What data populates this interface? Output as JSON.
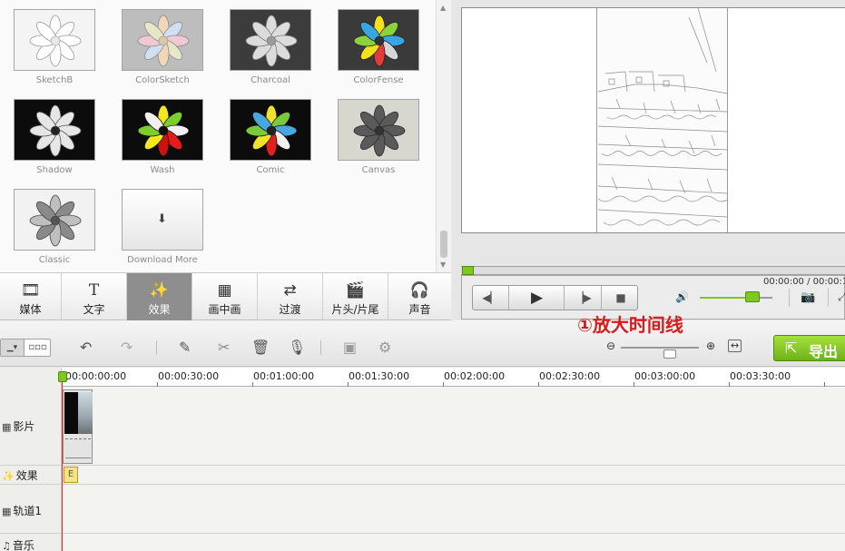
{
  "effects": [
    {
      "name": "SketchB",
      "style": "sketch"
    },
    {
      "name": "ColorSketch",
      "style": "colorsketch"
    },
    {
      "name": "Charcoal",
      "style": "charcoal"
    },
    {
      "name": "ColorFense",
      "style": "colorfense"
    },
    {
      "name": "Shadow",
      "style": "shadow"
    },
    {
      "name": "Wash",
      "style": "wash"
    },
    {
      "name": "Comic",
      "style": "comic"
    },
    {
      "name": "Canvas",
      "style": "canvas"
    },
    {
      "name": "Classic",
      "style": "classic"
    },
    {
      "name": "Download More",
      "style": "download"
    }
  ],
  "tabs": [
    {
      "label": "媒体",
      "icon": "media-icon"
    },
    {
      "label": "文字",
      "icon": "text-icon"
    },
    {
      "label": "效果",
      "icon": "effects-wand-icon",
      "active": true
    },
    {
      "label": "画中画",
      "icon": "pip-icon"
    },
    {
      "label": "过渡",
      "icon": "transition-icon"
    },
    {
      "label": "片头/片尾",
      "icon": "intro-outro-icon"
    },
    {
      "label": "声音",
      "icon": "headphones-icon"
    }
  ],
  "player": {
    "time": "00:00:00 / 00:00:1",
    "volume_level": 0.75,
    "seek_position": 0
  },
  "annotation": "①放大时间线",
  "export_label": "导出",
  "ruler": [
    "00:00:00:00",
    "00:00:30:00",
    "00:01:00:00",
    "00:01:30:00",
    "00:02:00:00",
    "00:02:30:00",
    "00:03:00:00",
    "00:03:30:00"
  ],
  "tracks": [
    "影片",
    "效果",
    "轨道1",
    "音乐"
  ],
  "fx_marker_label": "E",
  "colors": {
    "accent_green": "#7ec820",
    "annotation_red": "#d91a1a",
    "playhead_red": "#e53131"
  }
}
